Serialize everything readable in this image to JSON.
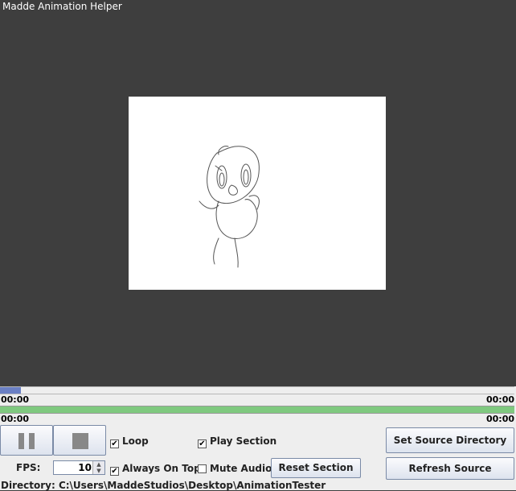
{
  "window": {
    "title": "Madde Animation Helper"
  },
  "timeline": {
    "progress": 0.04,
    "current_time": "00:00",
    "end_time": "00:00"
  },
  "section": {
    "progress": 1.0,
    "start_time": "00:00",
    "end_time": "00:00"
  },
  "buttons": {
    "pause_icon": "pause-icon",
    "stop_icon": "stop-icon",
    "set_source": "Set Source Directory",
    "refresh_source": "Refresh Source",
    "reset_section": "Reset Section"
  },
  "options": {
    "loop": {
      "label": "Loop",
      "checked": true,
      "mark": "✔"
    },
    "play_section": {
      "label": "Play Section",
      "checked": true,
      "mark": "✔"
    },
    "always_on_top": {
      "label": "Always On Top",
      "checked": true,
      "mark": "✔"
    },
    "mute_audio": {
      "label": "Mute Audio",
      "checked": false,
      "mark": ""
    }
  },
  "fps": {
    "label": "FPS:",
    "value": "10"
  },
  "directory": "Directory: C:\\Users\\MaddeStudios\\Desktop\\AnimationTester",
  "colors": {
    "section_bar": "#7fc97f",
    "thumb": "#6a7fc4",
    "background": "#3e3e3e"
  }
}
